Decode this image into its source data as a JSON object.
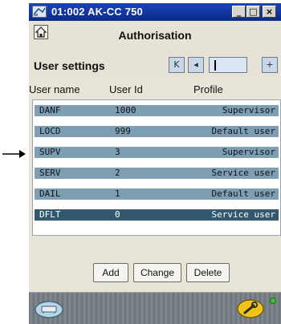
{
  "window": {
    "title": "01:002 AK-CC 750",
    "minimize": "_",
    "maximize": "□",
    "close": "×"
  },
  "header": {
    "title": "Authorisation",
    "section": "User settings"
  },
  "nav": {
    "first": "K",
    "prev": "◂",
    "next": "+"
  },
  "columns": {
    "username": "User name",
    "userid": "User Id",
    "profile": "Profile"
  },
  "users": [
    {
      "name": "DANF",
      "id": "1000",
      "profile": "Supervisor"
    },
    {
      "name": "LOCD",
      "id": "999",
      "profile": "Default user"
    },
    {
      "name": "SUPV",
      "id": "3",
      "profile": "Supervisor"
    },
    {
      "name": "SERV",
      "id": "2",
      "profile": "Service user"
    },
    {
      "name": "DAIL",
      "id": "1",
      "profile": "Default user"
    },
    {
      "name": "DFLT",
      "id": "0",
      "profile": "Service user"
    }
  ],
  "selected_index": 5,
  "buttons": {
    "add": "Add",
    "change": "Change",
    "delete": "Delete"
  },
  "status": {
    "led_color": "#3fbf2f"
  },
  "icons": {
    "title": "app-icon",
    "home": "home-icon",
    "left_status": "device-icon",
    "right_status": "wrench-icon",
    "pointer": "arrow-right-icon"
  }
}
